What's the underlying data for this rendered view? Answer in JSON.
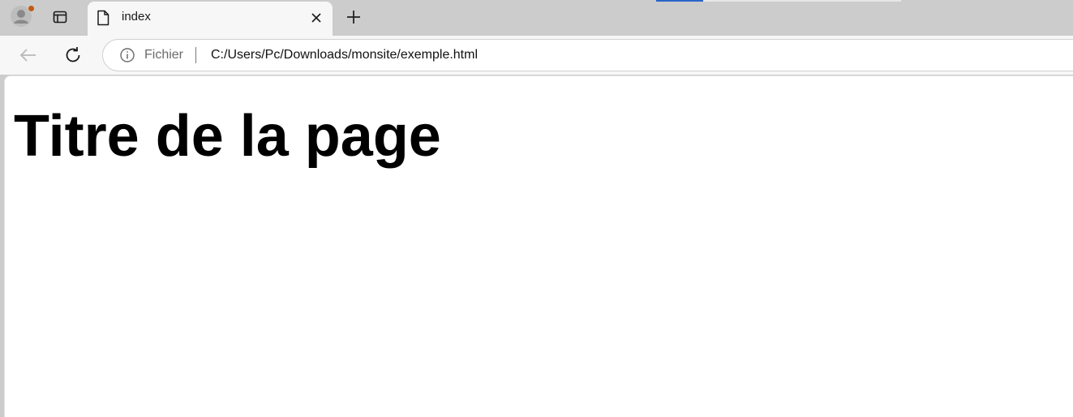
{
  "colors": {
    "tabbar_bg": "#cccccc",
    "toolbar_bg": "#f7f7f7",
    "page_bg": "#ffffff",
    "profile_badge": "#c45a10",
    "loading_accent": "#2b63c9"
  },
  "browser": {
    "profile": {
      "icon": "profile-avatar-icon"
    },
    "tab_actions_icon": "tab-actions-icon",
    "active_tab": {
      "title": "index",
      "icon": "file-icon",
      "close_icon": "close-icon"
    },
    "new_tab_icon": "plus-icon"
  },
  "toolbar": {
    "back_icon": "arrow-left-icon",
    "reload_icon": "reload-icon",
    "address": {
      "info_icon": "info-icon",
      "scheme_label": "Fichier",
      "url": "C:/Users/Pc/Downloads/monsite/exemple.html"
    }
  },
  "page": {
    "heading": "Titre de la page"
  }
}
